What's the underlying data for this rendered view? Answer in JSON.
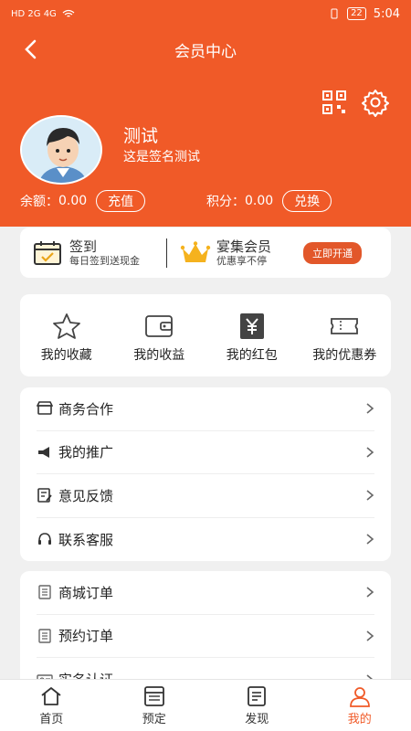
{
  "status_bar": {
    "left": "HD 2G 4G",
    "battery": "22",
    "time": "5:04"
  },
  "header": {
    "title": "会员中心"
  },
  "user": {
    "name": "测试",
    "signature": "这是签名测试"
  },
  "balance": {
    "label": "余额：",
    "value": "0.00",
    "button": "充值"
  },
  "points": {
    "label": "积分：",
    "value": "0.00",
    "button": "兑换"
  },
  "signin": {
    "title": "签到",
    "subtitle": "每日签到送现金"
  },
  "vip": {
    "title": "宴集会员",
    "subtitle": "优惠享不停",
    "button": "立即开通"
  },
  "grid": [
    {
      "label": "我的收藏",
      "icon": "star-icon"
    },
    {
      "label": "我的收益",
      "icon": "wallet-icon"
    },
    {
      "label": "我的红包",
      "icon": "yen-icon"
    },
    {
      "label": "我的优惠券",
      "icon": "coupon-icon"
    }
  ],
  "list1": [
    {
      "label": "商务合作",
      "icon": "store-icon"
    },
    {
      "label": "我的推广",
      "icon": "megaphone-icon"
    },
    {
      "label": "意见反馈",
      "icon": "feedback-icon"
    },
    {
      "label": "联系客服",
      "icon": "headset-icon"
    }
  ],
  "list2": [
    {
      "label": "商城订单",
      "icon": "order-icon"
    },
    {
      "label": "预约订单",
      "icon": "order-icon"
    },
    {
      "label": "实名认证",
      "icon": "id-card-icon"
    }
  ],
  "tabs": [
    {
      "label": "首页",
      "icon": "home-icon"
    },
    {
      "label": "预定",
      "icon": "calendar-icon"
    },
    {
      "label": "发现",
      "icon": "discover-icon"
    },
    {
      "label": "我的",
      "icon": "person-icon"
    }
  ],
  "colors": {
    "primary": "#f05a28",
    "background": "#f0f0f0"
  }
}
